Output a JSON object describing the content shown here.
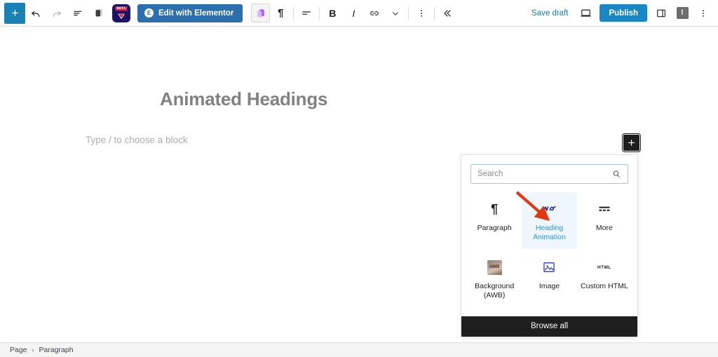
{
  "toolbar": {
    "add_block_label": "+",
    "undo_label": "undo-arrow",
    "redo_label": "redo-arrow",
    "list_view_label": "list-view",
    "details_label": "document-details",
    "beta_badge": "BETA",
    "elementor": {
      "label": "Edit with Elementor",
      "mark": "E",
      "color": "#2c6fad"
    },
    "block_type_glyph": "¶",
    "bold_label": "B",
    "italic_label": "I",
    "save_draft": "Save draft",
    "publish": "Publish",
    "publish_color": "#1a87c4",
    "notice_glyph": "!"
  },
  "canvas": {
    "post_title": "Animated Headings",
    "paragraph_placeholder": "Type / to choose a block",
    "inline_inserter_label": "+"
  },
  "inserter": {
    "search": {
      "placeholder": "Search",
      "value": ""
    },
    "blocks": [
      {
        "name": "Paragraph",
        "icon": "paragraph-icon",
        "selected": false
      },
      {
        "name": "Heading\nAnimation",
        "label_line1": "Heading",
        "label_line2": "Animation",
        "icon": "heading-animation-icon",
        "selected": true
      },
      {
        "name": "More",
        "icon": "more-icon",
        "selected": false
      },
      {
        "name": "Background\n(AWB)",
        "label_line1": "Background",
        "label_line2": "(AWB)",
        "icon": "awb-thumbnail-icon",
        "selected": false
      },
      {
        "name": "Image",
        "icon": "image-icon",
        "selected": false
      },
      {
        "name": "Custom HTML",
        "icon": "html-icon",
        "selected": false
      }
    ],
    "browse_all": "Browse all",
    "highlight_color": "#2b95d6",
    "annotation_arrow_color": "#e03a12"
  },
  "footer": {
    "breadcrumbs": [
      "Page",
      "Paragraph"
    ],
    "separator": "›"
  }
}
